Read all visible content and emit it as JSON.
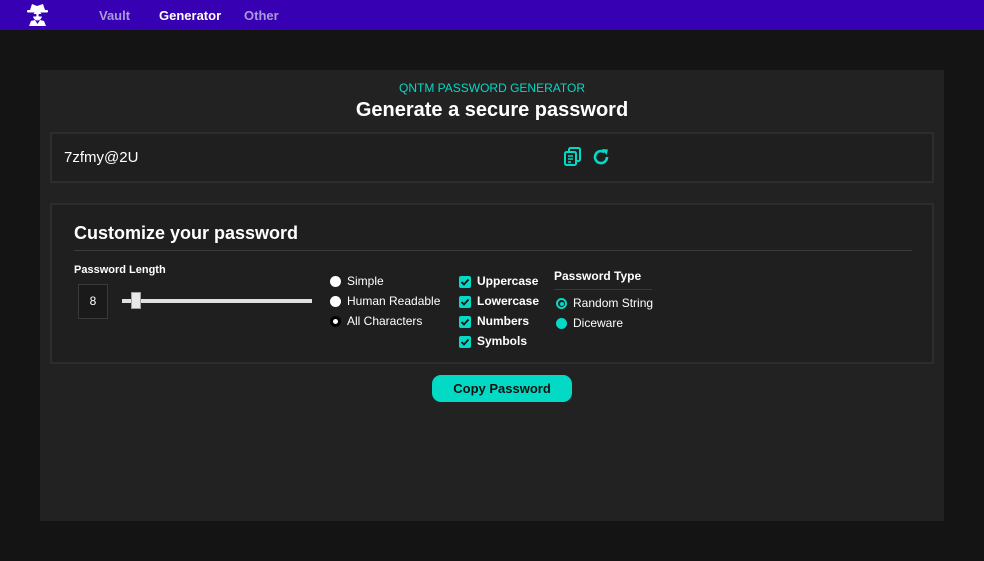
{
  "nav": {
    "logo_icon": "spy-logo-icon",
    "links": [
      "Vault",
      "Generator",
      "Other"
    ],
    "active": "Generator"
  },
  "header": {
    "subtitle": "QNTM PASSWORD GENERATOR",
    "title": "Generate a secure password"
  },
  "password": {
    "value": "7zfmy@2U",
    "copy_icon": "copy-icon",
    "refresh_icon": "refresh-icon"
  },
  "customize": {
    "title": "Customize your password",
    "length_label": "Password Length",
    "length_value": "8",
    "length_slider_fraction": 0.08,
    "modes": [
      {
        "label": "Simple",
        "selected": false
      },
      {
        "label": "Human Readable",
        "selected": false
      },
      {
        "label": "All Characters",
        "selected": true
      }
    ],
    "char_options": [
      {
        "label": "Uppercase",
        "checked": true
      },
      {
        "label": "Lowercase",
        "checked": true
      },
      {
        "label": "Numbers",
        "checked": true
      },
      {
        "label": "Symbols",
        "checked": true
      }
    ],
    "type_label": "Password Type",
    "types": [
      {
        "label": "Random String",
        "selected": true
      },
      {
        "label": "Diceware",
        "selected": false
      }
    ]
  },
  "copy_button": "Copy Password",
  "colors": {
    "nav_bg": "#3700b3",
    "accent": "#03dac6",
    "card_bg": "#222222",
    "page_bg": "#141414"
  }
}
